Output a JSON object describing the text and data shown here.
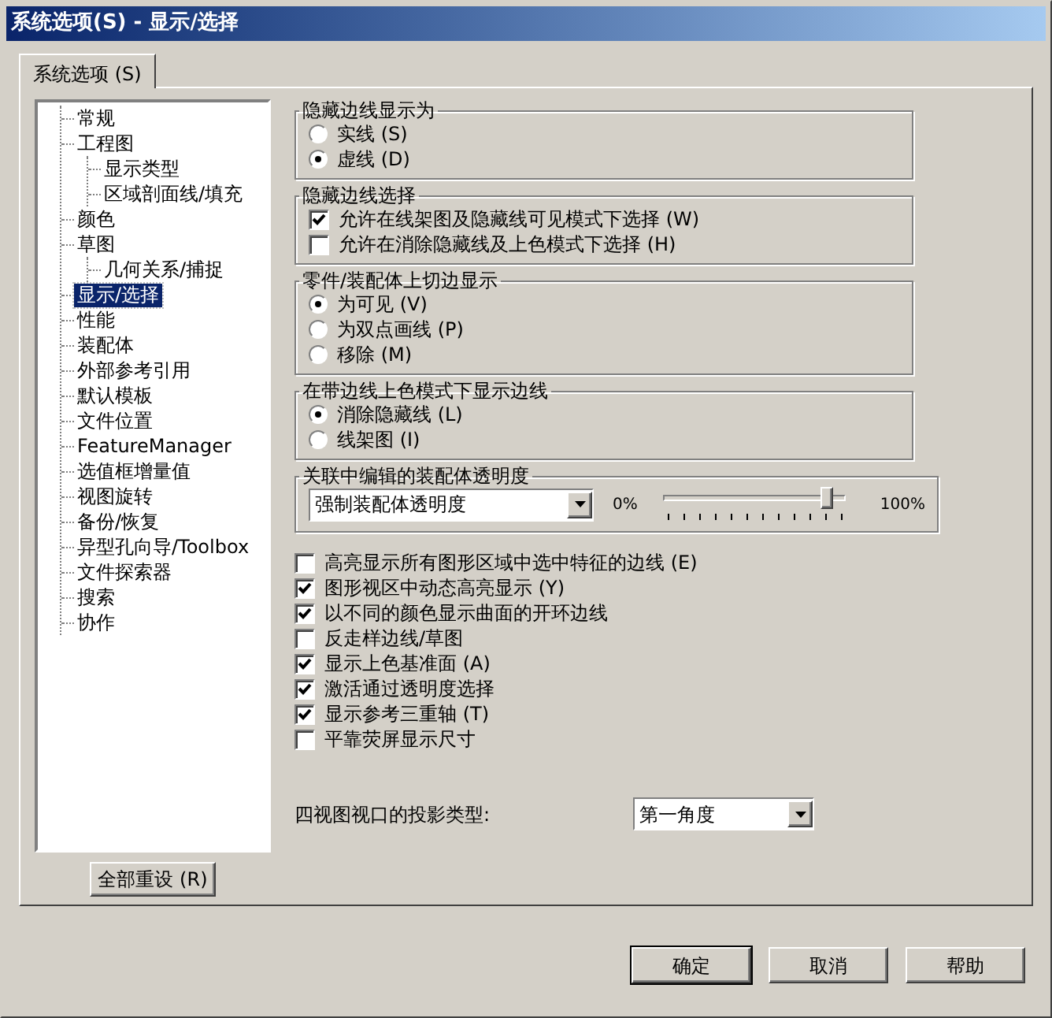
{
  "window": {
    "title": "系统选项(S) - 显示/选择"
  },
  "tabs": [
    {
      "label": "系统选项 (S)",
      "selected": true
    }
  ],
  "tree": {
    "items": [
      {
        "label": "常规",
        "selected": false
      },
      {
        "label": "工程图",
        "selected": false,
        "children": [
          {
            "label": "显示类型",
            "selected": false
          },
          {
            "label": "区域剖面线/填充",
            "selected": false
          }
        ]
      },
      {
        "label": "颜色",
        "selected": false
      },
      {
        "label": "草图",
        "selected": false,
        "children": [
          {
            "label": "几何关系/捕捉",
            "selected": false
          }
        ]
      },
      {
        "label": "显示/选择",
        "selected": true
      },
      {
        "label": "性能",
        "selected": false
      },
      {
        "label": "装配体",
        "selected": false
      },
      {
        "label": "外部参考引用",
        "selected": false
      },
      {
        "label": "默认模板",
        "selected": false
      },
      {
        "label": "文件位置",
        "selected": false
      },
      {
        "label": "FeatureManager",
        "selected": false
      },
      {
        "label": "选值框增量值",
        "selected": false
      },
      {
        "label": "视图旋转",
        "selected": false
      },
      {
        "label": "备份/恢复",
        "selected": false
      },
      {
        "label": "异型孔向导/Toolbox",
        "selected": false
      },
      {
        "label": "文件探索器",
        "selected": false
      },
      {
        "label": "搜索",
        "selected": false
      },
      {
        "label": "协作",
        "selected": false
      }
    ]
  },
  "reset_button": "全部重设 (R)",
  "groups": [
    {
      "title": "隐藏边线显示为",
      "kind": "radio",
      "options": [
        {
          "label": "实线 (S)",
          "selected": false
        },
        {
          "label": "虚线 (D)",
          "selected": true
        }
      ]
    },
    {
      "title": "隐藏边线选择",
      "kind": "checkbox",
      "options": [
        {
          "label": "允许在线架图及隐藏线可见模式下选择 (W)",
          "checked": true
        },
        {
          "label": "允许在消除隐藏线及上色模式下选择 (H)",
          "checked": false
        }
      ]
    },
    {
      "title": "零件/装配体上切边显示",
      "kind": "radio",
      "options": [
        {
          "label": "为可见 (V)",
          "selected": true
        },
        {
          "label": "为双点画线 (P)",
          "selected": false
        },
        {
          "label": "移除 (M)",
          "selected": false
        }
      ]
    },
    {
      "title": "在带边线上色模式下显示边线",
      "kind": "radio",
      "options": [
        {
          "label": "消除隐藏线 (L)",
          "selected": true
        },
        {
          "label": "线架图 (I)",
          "selected": false
        }
      ]
    }
  ],
  "transparency": {
    "title": "关联中编辑的装配体透明度",
    "dropdown": {
      "value": "强制装配体透明度"
    },
    "min_label": "0%",
    "max_label": "100%",
    "slider": {
      "level": 0.9
    }
  },
  "checkboxes": [
    {
      "label": "高亮显示所有图形区域中选中特征的边线 (E)",
      "checked": false
    },
    {
      "label": "图形视区中动态高亮显示 (Y)",
      "checked": true
    },
    {
      "label": "以不同的颜色显示曲面的开环边线",
      "checked": true
    },
    {
      "label": "反走样边线/草图",
      "checked": false
    },
    {
      "label": "显示上色基准面 (A)",
      "checked": true
    },
    {
      "label": "激活通过透明度选择",
      "checked": true
    },
    {
      "label": "显示参考三重轴 (T)",
      "checked": true
    },
    {
      "label": "平靠荧屏显示尺寸",
      "checked": false
    }
  ],
  "projection": {
    "label": "四视图视口的投影类型:",
    "dropdown": {
      "value": "第一角度"
    }
  },
  "buttons": [
    {
      "label": "确定",
      "default": true
    },
    {
      "label": "取消",
      "default": false
    },
    {
      "label": "帮助",
      "default": false
    }
  ]
}
